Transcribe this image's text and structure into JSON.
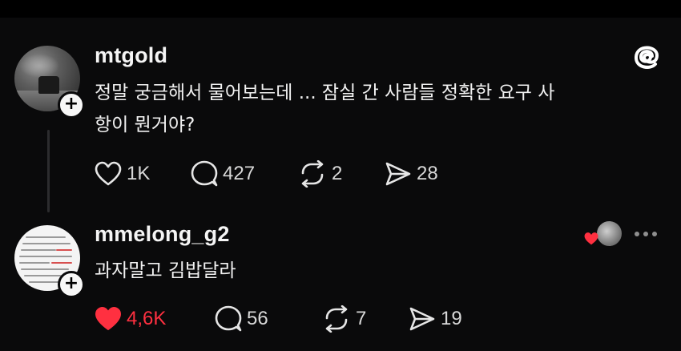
{
  "posts": [
    {
      "username": "mtgold",
      "text_line1": "정말 궁금해서 물어보는데 ... 잠실 간 사람들 정확한 요구 사",
      "text_line2": "항이 뭔거야?",
      "likes": "1K",
      "replies": "427",
      "reposts": "2",
      "shares": "28",
      "liked": false
    },
    {
      "username": "mmelong_g2",
      "text_line1": "과자말고 김밥달라",
      "likes": "4,6K",
      "replies": "56",
      "reposts": "7",
      "shares": "19",
      "liked": true
    }
  ],
  "icons": {
    "plus": "+",
    "threads": "threads-logo",
    "like": "heart-icon",
    "reply": "comment-icon",
    "repost": "repost-icon",
    "share": "send-icon"
  },
  "colors": {
    "background": "#0a0a0b",
    "text": "#f3f3f3",
    "secondary": "#d8d8d8",
    "like_active": "#ff3040"
  }
}
